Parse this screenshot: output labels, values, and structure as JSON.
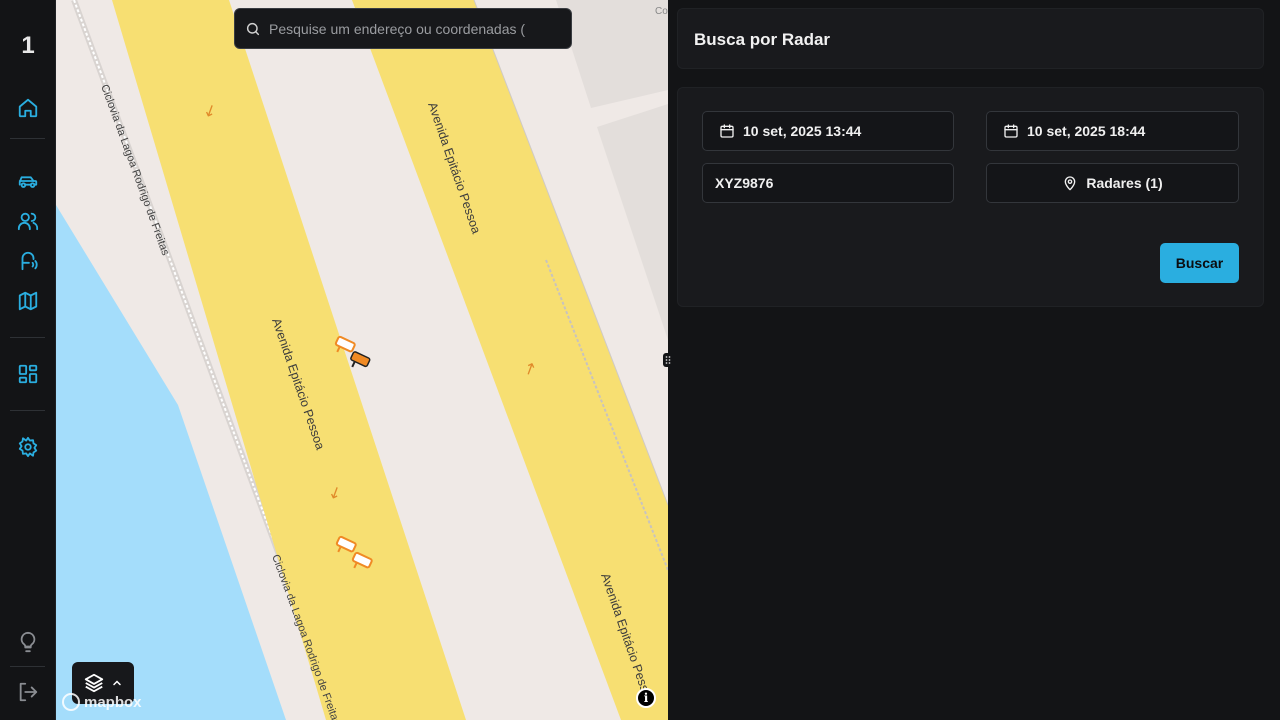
{
  "sidebar": {
    "logo": "1",
    "items": [
      {
        "icon": "home-icon"
      },
      {
        "icon": "car-icon"
      },
      {
        "icon": "users-icon"
      },
      {
        "icon": "radar-signal-icon"
      },
      {
        "icon": "map-icon"
      },
      {
        "icon": "dashboard-icon"
      },
      {
        "icon": "settings-icon"
      },
      {
        "icon": "lightbulb-icon"
      },
      {
        "icon": "logout-icon"
      }
    ],
    "accent": "#2aaee0"
  },
  "map": {
    "search_placeholder": "Pesquise um endereço ou coordenadas (",
    "streets": [
      "Avenida Epitácio Pessoa",
      "Avenida Epitácio Pessoa",
      "Avenida Epitácio Pessoa",
      "Ciclovia da Lagoa Rodrigo de Freitas",
      "Ciclovia da Lagoa Rodrigo de Freitas"
    ],
    "attribution": "Co",
    "provider": "mapbox",
    "info": "i"
  },
  "panel": {
    "title": "Busca por Radar",
    "start_date": "10 set, 2025 13:44",
    "end_date": "10 set, 2025 18:44",
    "plate": "XYZ9876",
    "radars_label": "Radares (1)",
    "search_button": "Buscar"
  },
  "colors": {
    "background": "#131416",
    "panel": "#191a1d",
    "road": "#f7df72",
    "water": "#a4ddfb",
    "land": "#efe9e6",
    "camera": "#f08a24"
  }
}
